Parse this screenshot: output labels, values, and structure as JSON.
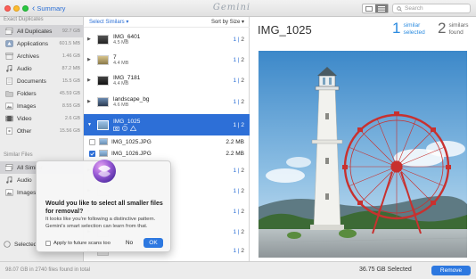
{
  "toolbar": {
    "back_label": "Summary",
    "app_title": "Gemini",
    "search_placeholder": "Search"
  },
  "sidebar": {
    "exact_heading": "Exact Duplicates",
    "exact_items": [
      {
        "label": "All Duplicates",
        "size": "92.7 GB",
        "icon": "stack-icon"
      },
      {
        "label": "Applications",
        "size": "601.5 MB",
        "icon": "applications-icon"
      },
      {
        "label": "Archives",
        "size": "1.46 GB",
        "icon": "archive-icon"
      },
      {
        "label": "Audio",
        "size": "87.2 MB",
        "icon": "music-note-icon"
      },
      {
        "label": "Documents",
        "size": "15.5 GB",
        "icon": "document-icon"
      },
      {
        "label": "Folders",
        "size": "45.59 GB",
        "icon": "folder-icon"
      },
      {
        "label": "Images",
        "size": "8.55 GB",
        "icon": "image-icon"
      },
      {
        "label": "Video",
        "size": "2.6 GB",
        "icon": "film-icon"
      },
      {
        "label": "Other",
        "size": "15.56 GB",
        "icon": "other-file-icon"
      }
    ],
    "similar_heading": "Similar Files",
    "similar_items": [
      {
        "label": "All Similar",
        "icon": "stack-icon"
      },
      {
        "label": "Audio",
        "icon": "music-note-icon"
      },
      {
        "label": "Images",
        "icon": "image-icon"
      }
    ],
    "select_label": "Selected"
  },
  "list": {
    "select_similars": "Select Similars ▾",
    "sort_label": "Sort by Size ▾",
    "groups": [
      {
        "name": "IMG_6401",
        "size": "4.5 MB",
        "count_a": "1",
        "count_b": "2"
      },
      {
        "name": "7",
        "size": "4.4 MB",
        "count_a": "1",
        "count_b": "2"
      },
      {
        "name": "IMG_7181",
        "size": "4.4 MB",
        "count_a": "1",
        "count_b": "2"
      },
      {
        "name": "landscape_bg",
        "size": "4.6 MB",
        "count_a": "1",
        "count_b": "2"
      }
    ],
    "selected_group": {
      "name": "IMG_1025",
      "count_a": "1",
      "count_b": "2"
    },
    "files": [
      {
        "name": "IMG_1025.JPG",
        "size": "2.2 MB",
        "checked": false
      },
      {
        "name": "IMG_1026.JPG",
        "size": "2.2 MB",
        "checked": true
      }
    ],
    "more_groups": [
      {
        "count_a": "1",
        "count_b": "2"
      },
      {
        "count_a": "1",
        "count_b": "2"
      },
      {
        "count_a": "1",
        "count_b": "2"
      },
      {
        "count_a": "1",
        "count_b": "2"
      },
      {
        "count_a": "1",
        "count_b": "2"
      },
      {
        "count_a": "1",
        "count_b": "2"
      },
      {
        "count_a": "1",
        "count_b": "2"
      }
    ]
  },
  "detail": {
    "title": "IMG_1025",
    "selected_count": "1",
    "selected_line1": "similar",
    "selected_line2": "selected",
    "found_count": "2",
    "found_line1": "similars",
    "found_line2": "found"
  },
  "dialog": {
    "title": "Would you like to select all smaller files for removal?",
    "body": "It looks like you're following a distinctive pattern. Gemini's smart selection can learn from that.",
    "checkbox_label": "Apply to future scans too",
    "no_label": "No",
    "ok_label": "OK"
  },
  "bottombar": {
    "info": "98.07 GB in 2740 files found in total",
    "selected_size": "36.75 GB Selected",
    "remove_label": "Remove"
  },
  "colors": {
    "accent": "#2d78e0",
    "selection": "#2d6fd7",
    "similar_text": "#2b8be0"
  }
}
